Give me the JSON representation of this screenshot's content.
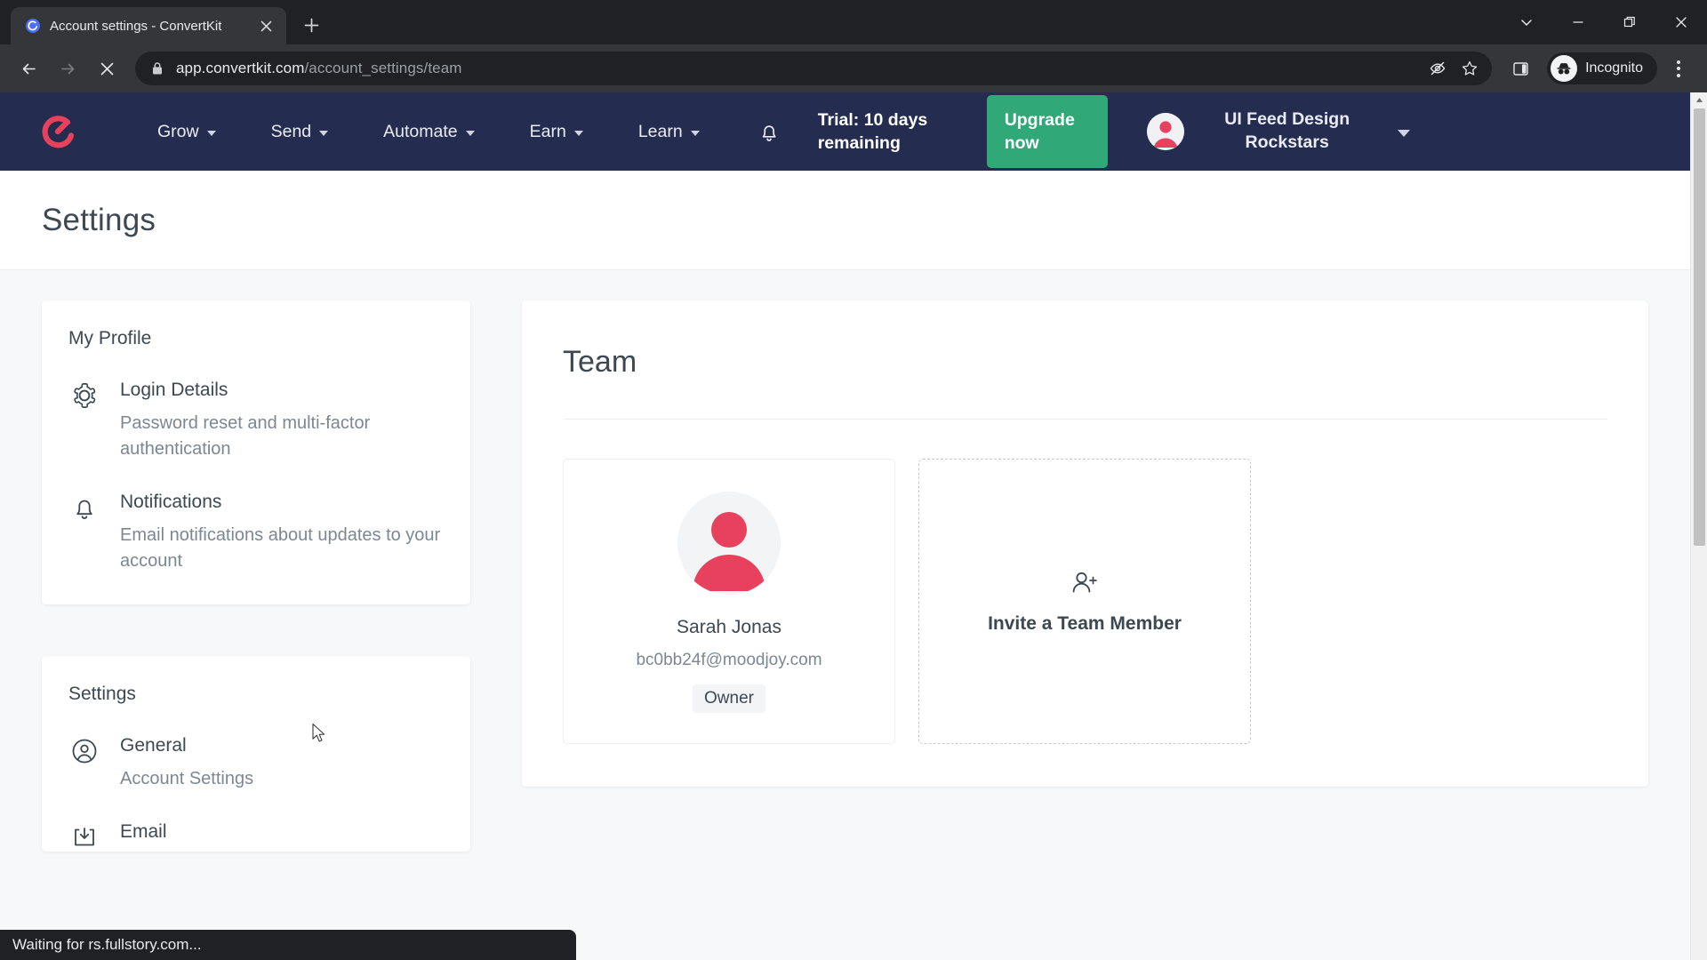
{
  "browser": {
    "tab": {
      "title": "Account settings - ConvertKit",
      "favicon_icon": "convertkit-favicon",
      "close_icon": "close-icon"
    },
    "new_tab_label": "+",
    "window_controls": [
      {
        "name": "tab-search",
        "glyph": "chevron-down-icon"
      },
      {
        "name": "minimize",
        "glyph": "minimize-icon"
      },
      {
        "name": "restore",
        "glyph": "restore-icon"
      },
      {
        "name": "close",
        "glyph": "close-icon"
      }
    ],
    "toolbar": {
      "back_icon": "back-arrow-icon",
      "forward_icon": "forward-arrow-icon",
      "stop_icon": "stop-loading-icon",
      "lock_icon": "lock-icon",
      "url_host": "app.convertkit.com",
      "url_path": "/account_settings/team",
      "third_party_cookie_icon": "eye-slash-icon",
      "bookmark_icon": "star-icon",
      "side_panel_icon": "side-panel-icon",
      "incognito_icon": "incognito-icon",
      "incognito_label": "Incognito",
      "menu_icon": "three-dot-menu-icon"
    }
  },
  "app": {
    "logo_icon": "convertkit-logo",
    "nav_items": [
      {
        "label": "Grow"
      },
      {
        "label": "Send"
      },
      {
        "label": "Automate"
      },
      {
        "label": "Earn"
      },
      {
        "label": "Learn"
      }
    ],
    "notifications_icon": "bell-icon",
    "trial_text": "Trial: 10 days remaining",
    "upgrade_label": "Upgrade now",
    "avatar_icon": "user-avatar-icon",
    "account_name": "UI Feed Design Rockstars",
    "account_chevron_icon": "chevron-down-icon"
  },
  "page": {
    "title": "Settings"
  },
  "sidebar": {
    "sections": [
      {
        "heading": "My Profile",
        "items": [
          {
            "icon": "gear-icon",
            "label": "Login Details",
            "description": "Password reset and multi-factor authentication"
          },
          {
            "icon": "bell-icon",
            "label": "Notifications",
            "description": "Email notifications about updates to your account"
          }
        ]
      },
      {
        "heading": "Settings",
        "items": [
          {
            "icon": "user-circle-icon",
            "label": "General",
            "description": "Account Settings"
          },
          {
            "icon": "inbox-download-icon",
            "label": "Email",
            "description": ""
          }
        ]
      }
    ]
  },
  "team": {
    "title": "Team",
    "members": [
      {
        "avatar_icon": "user-avatar-icon",
        "name": "Sarah Jonas",
        "email": "bc0bb24f@moodjoy.com",
        "role": "Owner"
      }
    ],
    "invite": {
      "icon": "user-plus-icon",
      "label": "Invite a Team Member"
    }
  },
  "status": {
    "text": "Waiting for rs.fullstory.com..."
  },
  "colors": {
    "nav_background": "#242d50",
    "brand_pink": "#e8415e",
    "upgrade_green": "#30a877",
    "text_dark": "#3d4852",
    "text_muted": "#7d8794",
    "page_background": "#f7f8f9"
  }
}
